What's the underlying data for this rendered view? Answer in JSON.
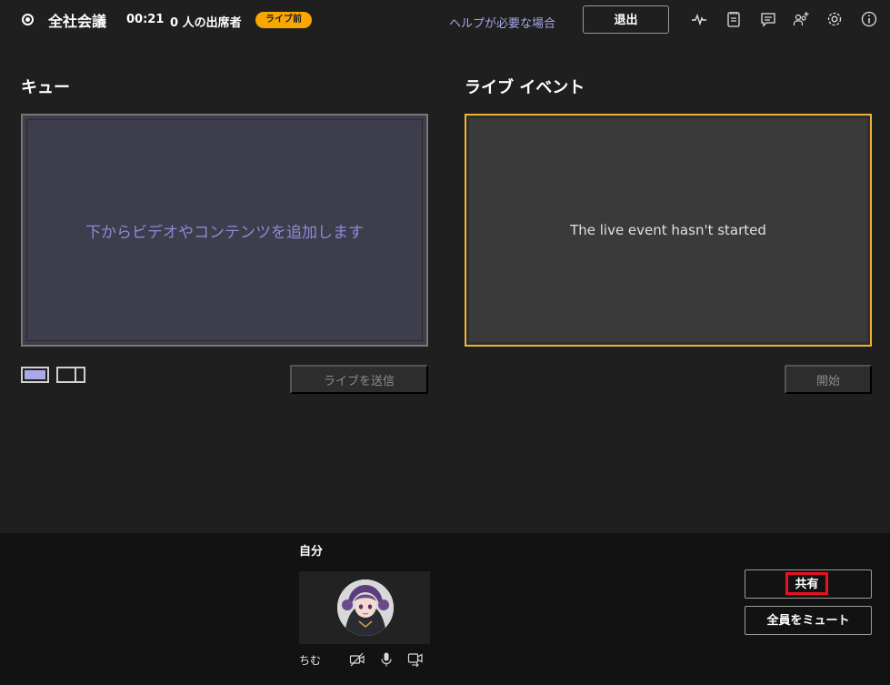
{
  "header": {
    "title": "全社会議",
    "timer": "00:21",
    "attendees": "0 人の出席者",
    "badge": "ライブ前",
    "help_link": "ヘルプが必要な場合",
    "exit_label": "退出",
    "icons": [
      "recording-icon",
      "health-icon",
      "notes-icon",
      "chat-icon",
      "people-add-icon",
      "settings-icon",
      "info-icon"
    ]
  },
  "queue": {
    "title": "キュー",
    "placeholder": "下からビデオやコンテンツを追加します",
    "send_live_label": "ライブを送信",
    "layouts": [
      "single-layout",
      "split-layout"
    ]
  },
  "live_event": {
    "title": "ライブ イベント",
    "status": "The live event hasn't started",
    "start_label": "開始"
  },
  "tray": {
    "self_label": "自分",
    "self_name": "ちむ",
    "controls": [
      "camera-off-icon",
      "microphone-icon",
      "video-switch-icon"
    ],
    "share_label": "共有",
    "mute_all_label": "全員をミュート"
  },
  "colors": {
    "background": "#1f1f1f",
    "tray_background": "#121212",
    "accent_live": "#f0b232",
    "badge": "#f8a800",
    "link": "#a7a8e8",
    "highlight": "#e81123"
  }
}
